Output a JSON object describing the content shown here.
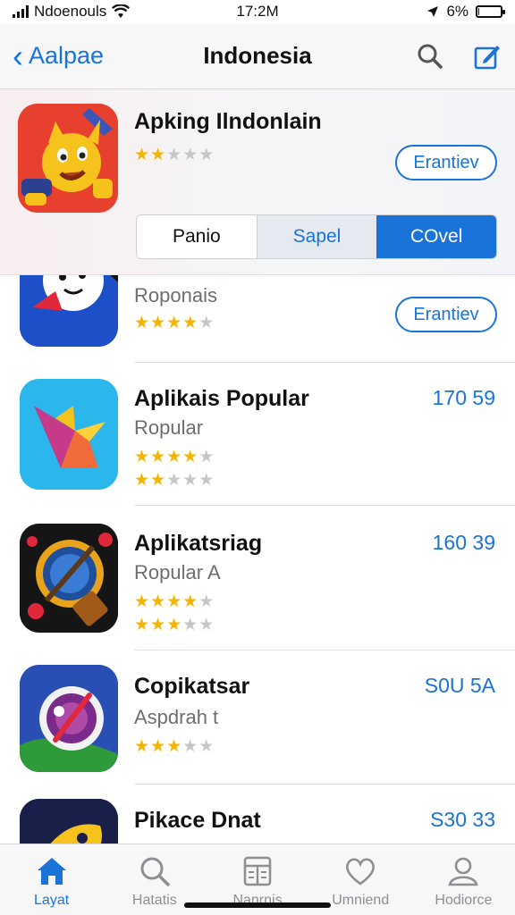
{
  "status_bar": {
    "carrier": "Ndoenouls",
    "time": "17:2M",
    "battery": "6%",
    "battery_level": 0.06
  },
  "nav": {
    "back_label": "Aalpae",
    "title": "Indonesia"
  },
  "featured": {
    "title": "Apking Ilndonlain",
    "rating": 2,
    "get_label": "Erantiev",
    "segments": [
      "Panio",
      "Sapel",
      "COvel"
    ],
    "selected_segment": 2
  },
  "apps": [
    {
      "title": "",
      "subtitle": "Roponais",
      "ratings": [
        4
      ],
      "action": "Erantiev",
      "price": ""
    },
    {
      "title": "Aplikais Popular",
      "subtitle": "Ropular",
      "ratings": [
        4,
        2
      ],
      "action": "",
      "price": "170 59"
    },
    {
      "title": "Aplikatsriag",
      "subtitle": "Ropular A",
      "ratings": [
        4,
        3
      ],
      "action": "",
      "price": "160 39"
    },
    {
      "title": "Copikatsar",
      "subtitle": "Aspdrah t",
      "ratings": [
        3
      ],
      "action": "",
      "price": "S0U 5A"
    },
    {
      "title": "Pikace Dnat",
      "subtitle": "",
      "ratings": [],
      "action": "",
      "price": "S30 33"
    }
  ],
  "tabs": [
    {
      "label": "Layat",
      "icon": "home-icon",
      "active": true
    },
    {
      "label": "Hatatis",
      "icon": "search-icon",
      "active": false
    },
    {
      "label": "Nanrnis",
      "icon": "list-icon",
      "active": false
    },
    {
      "label": "Umniend",
      "icon": "heart-icon",
      "active": false
    },
    {
      "label": "Hodiorce",
      "icon": "profile-icon",
      "active": false
    }
  ],
  "colors": {
    "accent": "#1a73d9",
    "star": "#f5b400"
  }
}
